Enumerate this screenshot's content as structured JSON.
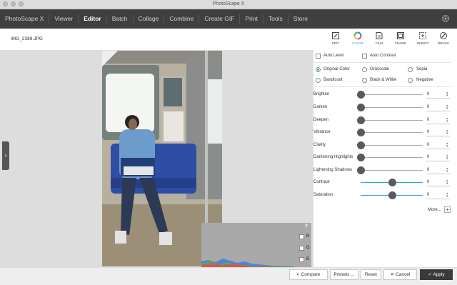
{
  "window": {
    "title": "PhotoScape X"
  },
  "menu": {
    "items": [
      "PhotoScape X",
      "Viewer",
      "Editor",
      "Batch",
      "Collage",
      "Combine",
      "Create GIF",
      "Print",
      "Tools",
      "Store"
    ],
    "active": "Editor"
  },
  "toolbar": {
    "filename": "IMG_2389.JPG",
    "tools": [
      {
        "label": "EDIT",
        "icon": "edit-icon"
      },
      {
        "label": "COLOR",
        "icon": "color-wheel-icon"
      },
      {
        "label": "FILM",
        "icon": "film-icon"
      },
      {
        "label": "FRAME",
        "icon": "frame-icon"
      },
      {
        "label": "INSERT",
        "icon": "insert-icon"
      },
      {
        "label": "BRUSH",
        "icon": "brush-icon"
      }
    ],
    "active": "COLOR"
  },
  "panel": {
    "auto_level": "Auto Level",
    "auto_contrast": "Auto Contrast",
    "modes": {
      "original": "Original Color",
      "grayscale": "Grayscale",
      "sepia": "Sepia",
      "bandicoot": "Bandicoot",
      "black_white": "Black & White",
      "negative": "Negative"
    },
    "selected_mode": "Original Color",
    "sliders": [
      {
        "label": "Brighten",
        "value": "0",
        "level": 0
      },
      {
        "label": "Darken",
        "value": "0",
        "level": 0
      },
      {
        "label": "Deepen",
        "value": "0",
        "level": 0
      },
      {
        "label": "Vibrance",
        "value": "0",
        "level": 0
      },
      {
        "label": "Clarity",
        "value": "0",
        "level": 0
      },
      {
        "label": "Darkening Highlights",
        "value": "0",
        "level": 0
      },
      {
        "label": "Lightening Shadows",
        "value": "0",
        "level": 0
      },
      {
        "label": "Contrast",
        "value": "0",
        "level": 0.5
      },
      {
        "label": "Saturation",
        "value": "0",
        "level": 0.5
      }
    ],
    "more": "More...",
    "plus": "+"
  },
  "histogram": {
    "channels": [
      "R",
      "G",
      "B"
    ],
    "close": "✕"
  },
  "bottom": {
    "compare": "Compare",
    "presets": "Presets ...",
    "reset": "Reset",
    "cancel": "Cancel",
    "apply": "Apply"
  },
  "colors": {
    "accent": "#2aa5d4",
    "menubar": "#3f3f3f"
  }
}
